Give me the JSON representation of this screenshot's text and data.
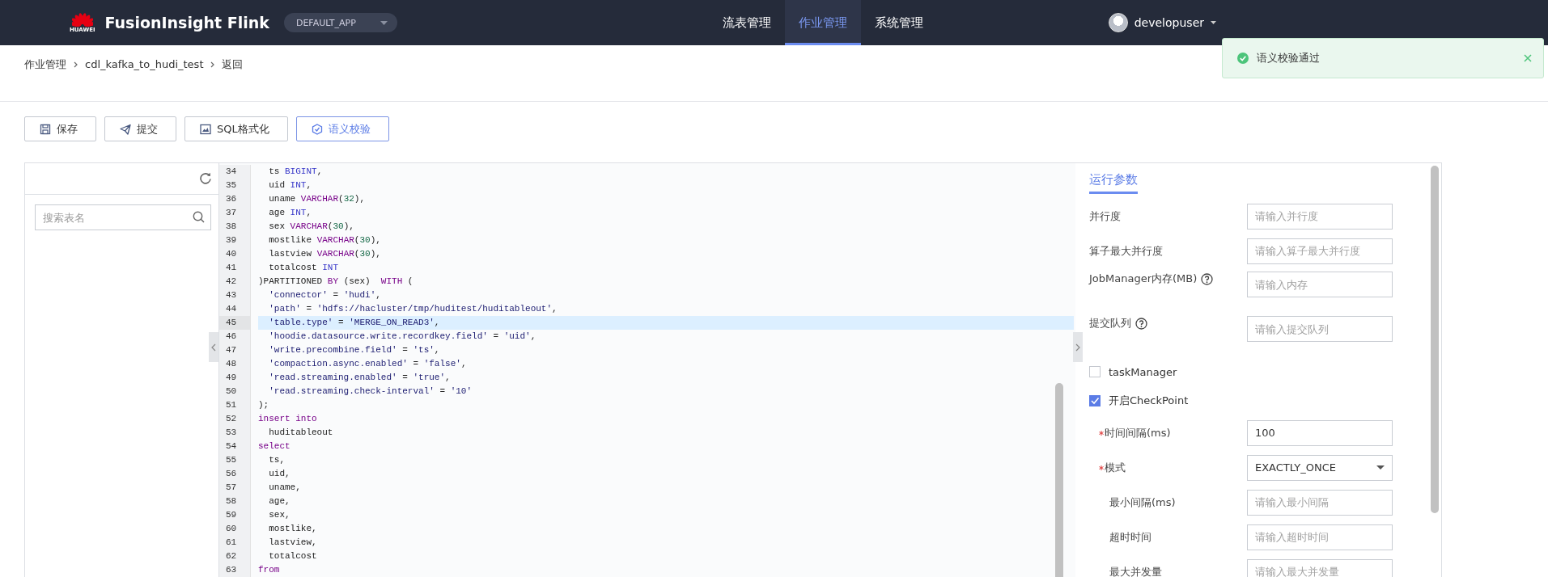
{
  "header": {
    "logo_caption": "HUAWEI",
    "brand": "FusionInsight Flink",
    "app_selector": "DEFAULT_APP",
    "nav": [
      {
        "label": "流表管理",
        "selected": false
      },
      {
        "label": "作业管理",
        "selected": true
      },
      {
        "label": "系统管理",
        "selected": false
      }
    ],
    "user": "developuser"
  },
  "toast": {
    "message": "语义校验通过"
  },
  "breadcrumb": [
    {
      "label": "作业管理"
    },
    {
      "label": "cdl_kafka_to_hudi_test"
    },
    {
      "label": "返回"
    }
  ],
  "toolbar": [
    {
      "label": "保存",
      "selected": false
    },
    {
      "label": "提交",
      "selected": false
    },
    {
      "label": "SQL格式化",
      "selected": false
    },
    {
      "label": "语义校验",
      "selected": true
    }
  ],
  "table_list": {
    "search": {
      "placeholder": "搜索表名"
    }
  },
  "editor": {
    "lines": [
      {
        "number": "34",
        "active": false,
        "tokens": [
          {
            "kind": "plain",
            "text": "  ts "
          },
          {
            "kind": "type",
            "text": "BIGINT"
          },
          {
            "kind": "plain",
            "text": ","
          }
        ]
      },
      {
        "number": "35",
        "active": false,
        "tokens": [
          {
            "kind": "plain",
            "text": "  uid "
          },
          {
            "kind": "type",
            "text": "INT"
          },
          {
            "kind": "plain",
            "text": ","
          }
        ]
      },
      {
        "number": "36",
        "active": false,
        "tokens": [
          {
            "kind": "plain",
            "text": "  uname "
          },
          {
            "kind": "keyword",
            "text": "VARCHAR"
          },
          {
            "kind": "plain",
            "text": "("
          },
          {
            "kind": "number",
            "text": "32"
          },
          {
            "kind": "plain",
            "text": "),"
          }
        ]
      },
      {
        "number": "37",
        "active": false,
        "tokens": [
          {
            "kind": "plain",
            "text": "  age "
          },
          {
            "kind": "type",
            "text": "INT"
          },
          {
            "kind": "plain",
            "text": ","
          }
        ]
      },
      {
        "number": "38",
        "active": false,
        "tokens": [
          {
            "kind": "plain",
            "text": "  sex "
          },
          {
            "kind": "keyword",
            "text": "VARCHAR"
          },
          {
            "kind": "plain",
            "text": "("
          },
          {
            "kind": "number",
            "text": "30"
          },
          {
            "kind": "plain",
            "text": "),"
          }
        ]
      },
      {
        "number": "39",
        "active": false,
        "tokens": [
          {
            "kind": "plain",
            "text": "  mostlike "
          },
          {
            "kind": "keyword",
            "text": "VARCHAR"
          },
          {
            "kind": "plain",
            "text": "("
          },
          {
            "kind": "number",
            "text": "30"
          },
          {
            "kind": "plain",
            "text": "),"
          }
        ]
      },
      {
        "number": "40",
        "active": false,
        "tokens": [
          {
            "kind": "plain",
            "text": "  lastview "
          },
          {
            "kind": "keyword",
            "text": "VARCHAR"
          },
          {
            "kind": "plain",
            "text": "("
          },
          {
            "kind": "number",
            "text": "30"
          },
          {
            "kind": "plain",
            "text": "),"
          }
        ]
      },
      {
        "number": "41",
        "active": false,
        "tokens": [
          {
            "kind": "plain",
            "text": "  totalcost "
          },
          {
            "kind": "type",
            "text": "INT"
          }
        ]
      },
      {
        "number": "42",
        "active": false,
        "tokens": [
          {
            "kind": "plain",
            "text": ")PARTITIONED "
          },
          {
            "kind": "keyword",
            "text": "BY"
          },
          {
            "kind": "plain",
            "text": " (sex)  "
          },
          {
            "kind": "keyword",
            "text": "WITH"
          },
          {
            "kind": "plain",
            "text": " ("
          }
        ]
      },
      {
        "number": "43",
        "active": false,
        "tokens": [
          {
            "kind": "string",
            "text": "  'connector'"
          },
          {
            "kind": "plain",
            "text": " = "
          },
          {
            "kind": "string",
            "text": "'hudi'"
          },
          {
            "kind": "plain",
            "text": ","
          }
        ]
      },
      {
        "number": "44",
        "active": false,
        "tokens": [
          {
            "kind": "string",
            "text": "  'path'"
          },
          {
            "kind": "plain",
            "text": " = "
          },
          {
            "kind": "string",
            "text": "'hdfs://hacluster/tmp/huditest/huditableout'"
          },
          {
            "kind": "plain",
            "text": ","
          }
        ]
      },
      {
        "number": "45",
        "active": true,
        "tokens": [
          {
            "kind": "string",
            "text": "  'table.type'"
          },
          {
            "kind": "plain",
            "text": " = "
          },
          {
            "kind": "string",
            "text": "'MERGE_ON_READ3'"
          },
          {
            "kind": "plain",
            "text": ","
          }
        ]
      },
      {
        "number": "46",
        "active": false,
        "tokens": [
          {
            "kind": "string",
            "text": "  'hoodie.datasource.write.recordkey.field'"
          },
          {
            "kind": "plain",
            "text": " = "
          },
          {
            "kind": "string",
            "text": "'uid'"
          },
          {
            "kind": "plain",
            "text": ","
          }
        ]
      },
      {
        "number": "47",
        "active": false,
        "tokens": [
          {
            "kind": "string",
            "text": "  'write.precombine.field'"
          },
          {
            "kind": "plain",
            "text": " = "
          },
          {
            "kind": "string",
            "text": "'ts'"
          },
          {
            "kind": "plain",
            "text": ","
          }
        ]
      },
      {
        "number": "48",
        "active": false,
        "tokens": [
          {
            "kind": "string",
            "text": "  'compaction.async.enabled'"
          },
          {
            "kind": "plain",
            "text": " = "
          },
          {
            "kind": "string",
            "text": "'false'"
          },
          {
            "kind": "plain",
            "text": ","
          }
        ]
      },
      {
        "number": "49",
        "active": false,
        "tokens": [
          {
            "kind": "string",
            "text": "  'read.streaming.enabled'"
          },
          {
            "kind": "plain",
            "text": " = "
          },
          {
            "kind": "string",
            "text": "'true'"
          },
          {
            "kind": "plain",
            "text": ","
          }
        ]
      },
      {
        "number": "50",
        "active": false,
        "tokens": [
          {
            "kind": "string",
            "text": "  'read.streaming.check-interval'"
          },
          {
            "kind": "plain",
            "text": " = "
          },
          {
            "kind": "string",
            "text": "'10'"
          }
        ]
      },
      {
        "number": "51",
        "active": false,
        "tokens": [
          {
            "kind": "plain",
            "text": ");"
          }
        ]
      },
      {
        "number": "52",
        "active": false,
        "tokens": [
          {
            "kind": "keyword",
            "text": "insert into"
          }
        ]
      },
      {
        "number": "53",
        "active": false,
        "tokens": [
          {
            "kind": "plain",
            "text": "  huditableout"
          }
        ]
      },
      {
        "number": "54",
        "active": false,
        "tokens": [
          {
            "kind": "keyword",
            "text": "select"
          }
        ]
      },
      {
        "number": "55",
        "active": false,
        "tokens": [
          {
            "kind": "plain",
            "text": "  ts,"
          }
        ]
      },
      {
        "number": "56",
        "active": false,
        "tokens": [
          {
            "kind": "plain",
            "text": "  uid,"
          }
        ]
      },
      {
        "number": "57",
        "active": false,
        "tokens": [
          {
            "kind": "plain",
            "text": "  uname,"
          }
        ]
      },
      {
        "number": "58",
        "active": false,
        "tokens": [
          {
            "kind": "plain",
            "text": "  age,"
          }
        ]
      },
      {
        "number": "59",
        "active": false,
        "tokens": [
          {
            "kind": "plain",
            "text": "  sex,"
          }
        ]
      },
      {
        "number": "60",
        "active": false,
        "tokens": [
          {
            "kind": "plain",
            "text": "  mostlike,"
          }
        ]
      },
      {
        "number": "61",
        "active": false,
        "tokens": [
          {
            "kind": "plain",
            "text": "  lastview,"
          }
        ]
      },
      {
        "number": "62",
        "active": false,
        "tokens": [
          {
            "kind": "plain",
            "text": "  totalcost"
          }
        ]
      },
      {
        "number": "63",
        "active": false,
        "tokens": [
          {
            "kind": "keyword",
            "text": "from"
          }
        ]
      }
    ]
  },
  "params": {
    "tab": "运行参数",
    "fields": [
      {
        "kind": "input",
        "label": "并行度",
        "placeholder": "请输入并行度",
        "help": false,
        "required": false,
        "sub": false
      },
      {
        "kind": "input",
        "label": "算子最大并行度",
        "placeholder": "请输入算子最大并行度",
        "help": false,
        "required": false,
        "sub": false
      },
      {
        "kind": "input",
        "label": "JobManager内存(MB)",
        "placeholder": "请输入内存",
        "help": true,
        "required": false,
        "sub": false
      },
      {
        "kind": "input",
        "label": "提交队列",
        "placeholder": "请输入提交队列",
        "help": true,
        "required": false,
        "sub": false
      },
      {
        "kind": "checkbox",
        "label": "taskManager",
        "checked": false
      },
      {
        "kind": "checkbox",
        "label": "开启CheckPoint",
        "checked": true
      },
      {
        "kind": "input",
        "label": "时间间隔(ms)",
        "value": "100",
        "help": false,
        "required": true,
        "sub": true
      },
      {
        "kind": "select",
        "label": "模式",
        "value": "EXACTLY_ONCE",
        "help": false,
        "required": true,
        "sub": true
      },
      {
        "kind": "input",
        "label": "最小间隔(ms)",
        "placeholder": "请输入最小间隔",
        "help": false,
        "required": false,
        "sub": true
      },
      {
        "kind": "input",
        "label": "超时时间",
        "placeholder": "请输入超时时间",
        "help": false,
        "required": false,
        "sub": true
      },
      {
        "kind": "input",
        "label": "最大并发量",
        "placeholder": "请输入最大并发量",
        "help": false,
        "required": false,
        "sub": true
      }
    ]
  }
}
